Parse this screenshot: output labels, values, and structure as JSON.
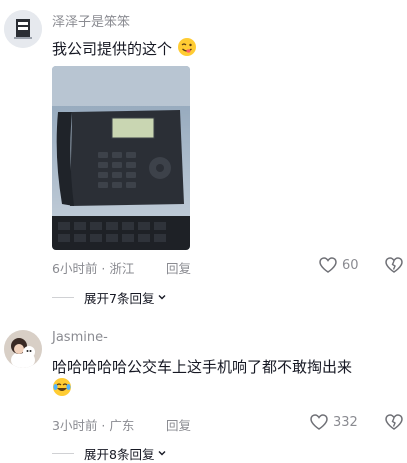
{
  "comments": [
    {
      "username": "泽泽子是笨笨",
      "text": "我公司提供的这个",
      "emoji": "winking-face-with-tongue",
      "time_location": "6小时前 · 浙江",
      "reply_label": "回复",
      "likes": "60",
      "expand_label": "展开7条回复"
    },
    {
      "username": "Jasmine-",
      "text": "哈哈哈哈哈公交车上这手机响了都不敢掏出来",
      "emoji": "face-with-tears-of-joy",
      "time_location": "3小时前 · 广东",
      "reply_label": "回复",
      "likes": "332",
      "expand_label": "展开8条回复"
    }
  ],
  "colors": {
    "primary_text": "#161823",
    "secondary_text": "#8a8b91"
  }
}
